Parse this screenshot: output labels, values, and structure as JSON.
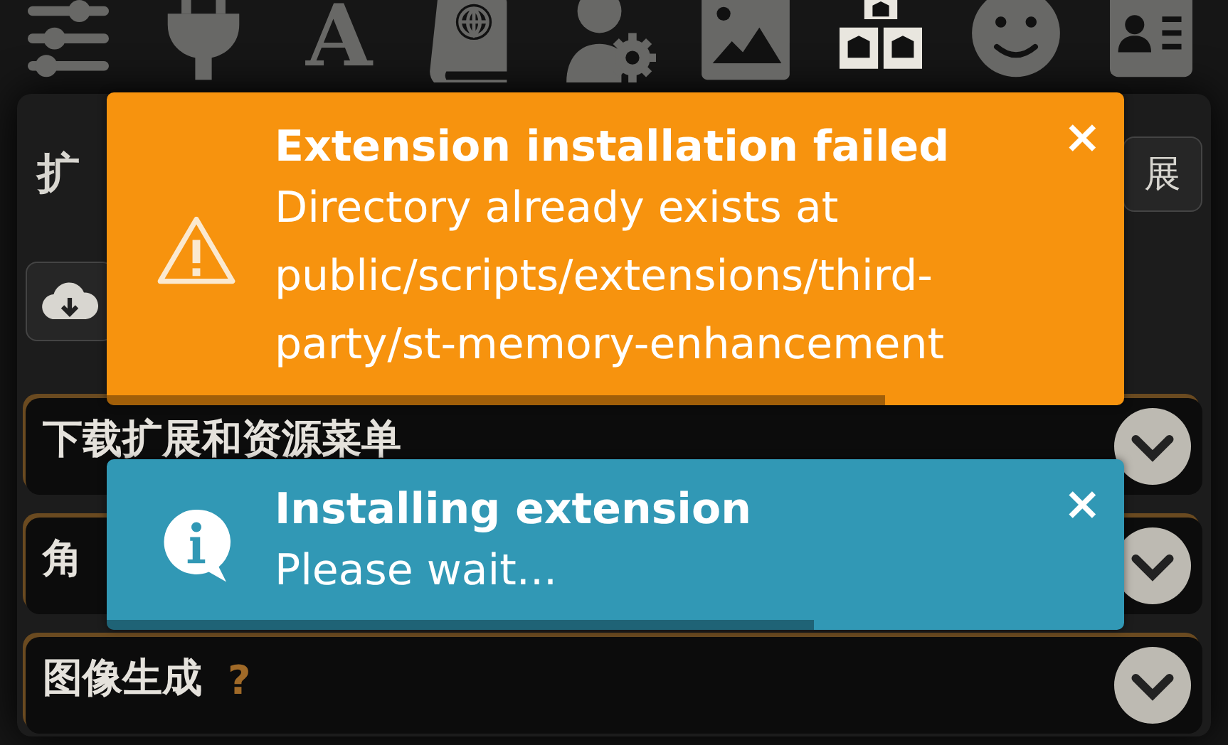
{
  "nav": [
    {
      "kind": "sliders",
      "selected": false
    },
    {
      "kind": "plug",
      "selected": false
    },
    {
      "kind": "font",
      "glyph": "A",
      "selected": false
    },
    {
      "kind": "book",
      "selected": false
    },
    {
      "kind": "user-gear",
      "selected": false
    },
    {
      "kind": "image",
      "selected": false
    },
    {
      "kind": "cubes",
      "selected": true
    },
    {
      "kind": "smiley",
      "selected": false
    },
    {
      "kind": "id-card",
      "selected": false
    }
  ],
  "panel": {
    "title": "扩",
    "header_button": "展",
    "drawers": [
      {
        "title": "下载扩展和资源菜单",
        "expanded": false
      },
      {
        "title": "角",
        "expanded": false
      },
      {
        "title": "图像生成",
        "help": "?",
        "expanded": false
      }
    ]
  },
  "toasts": [
    {
      "kind": "error",
      "title": "Extension installation failed",
      "message": "Directory already exists at public/scripts/extensions/third-party/st-memory-enhancement",
      "close": "×",
      "level": 0.765
    },
    {
      "kind": "info",
      "title": "Installing extension",
      "message": "Please wait...",
      "close": "×",
      "level": 0.695
    }
  ]
}
